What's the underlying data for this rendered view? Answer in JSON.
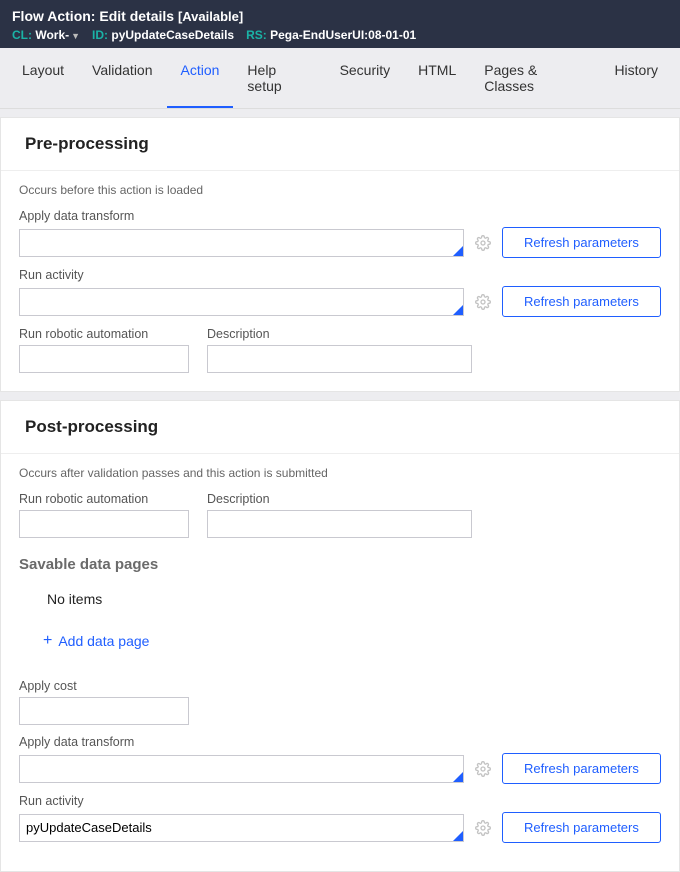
{
  "header": {
    "rule_type": "Flow Action:",
    "rule_name": "Edit details",
    "availability": "[Available]",
    "cl_label": "CL:",
    "cl_value": "Work-",
    "id_label": "ID:",
    "id_value": "pyUpdateCaseDetails",
    "rs_label": "RS:",
    "rs_value": "Pega-EndUserUI:08-01-01"
  },
  "tabs": {
    "items": [
      {
        "label": "Layout"
      },
      {
        "label": "Validation"
      },
      {
        "label": "Action"
      },
      {
        "label": "Help setup"
      },
      {
        "label": "Security"
      },
      {
        "label": "HTML"
      },
      {
        "label": "Pages & Classes"
      },
      {
        "label": "History"
      }
    ],
    "active_index": 2
  },
  "pre": {
    "title": "Pre-processing",
    "help": "Occurs before this action is loaded",
    "apply_dt_label": "Apply data transform",
    "apply_dt_value": "",
    "run_activity_label": "Run activity",
    "run_activity_value": "",
    "robotic_label": "Run robotic automation",
    "robotic_value": "",
    "desc_label": "Description",
    "desc_value": "",
    "refresh_label": "Refresh parameters"
  },
  "post": {
    "title": "Post-processing",
    "help": "Occurs after validation passes and this action is submitted",
    "robotic_label": "Run robotic automation",
    "robotic_value": "",
    "desc_label": "Description",
    "desc_value": "",
    "savable_heading": "Savable data pages",
    "no_items": "No items",
    "add_link": "Add data page",
    "apply_cost_label": "Apply cost",
    "apply_cost_value": "",
    "apply_dt_label": "Apply data transform",
    "apply_dt_value": "",
    "run_activity_label": "Run activity",
    "run_activity_value": "pyUpdateCaseDetails",
    "refresh_label": "Refresh parameters"
  }
}
